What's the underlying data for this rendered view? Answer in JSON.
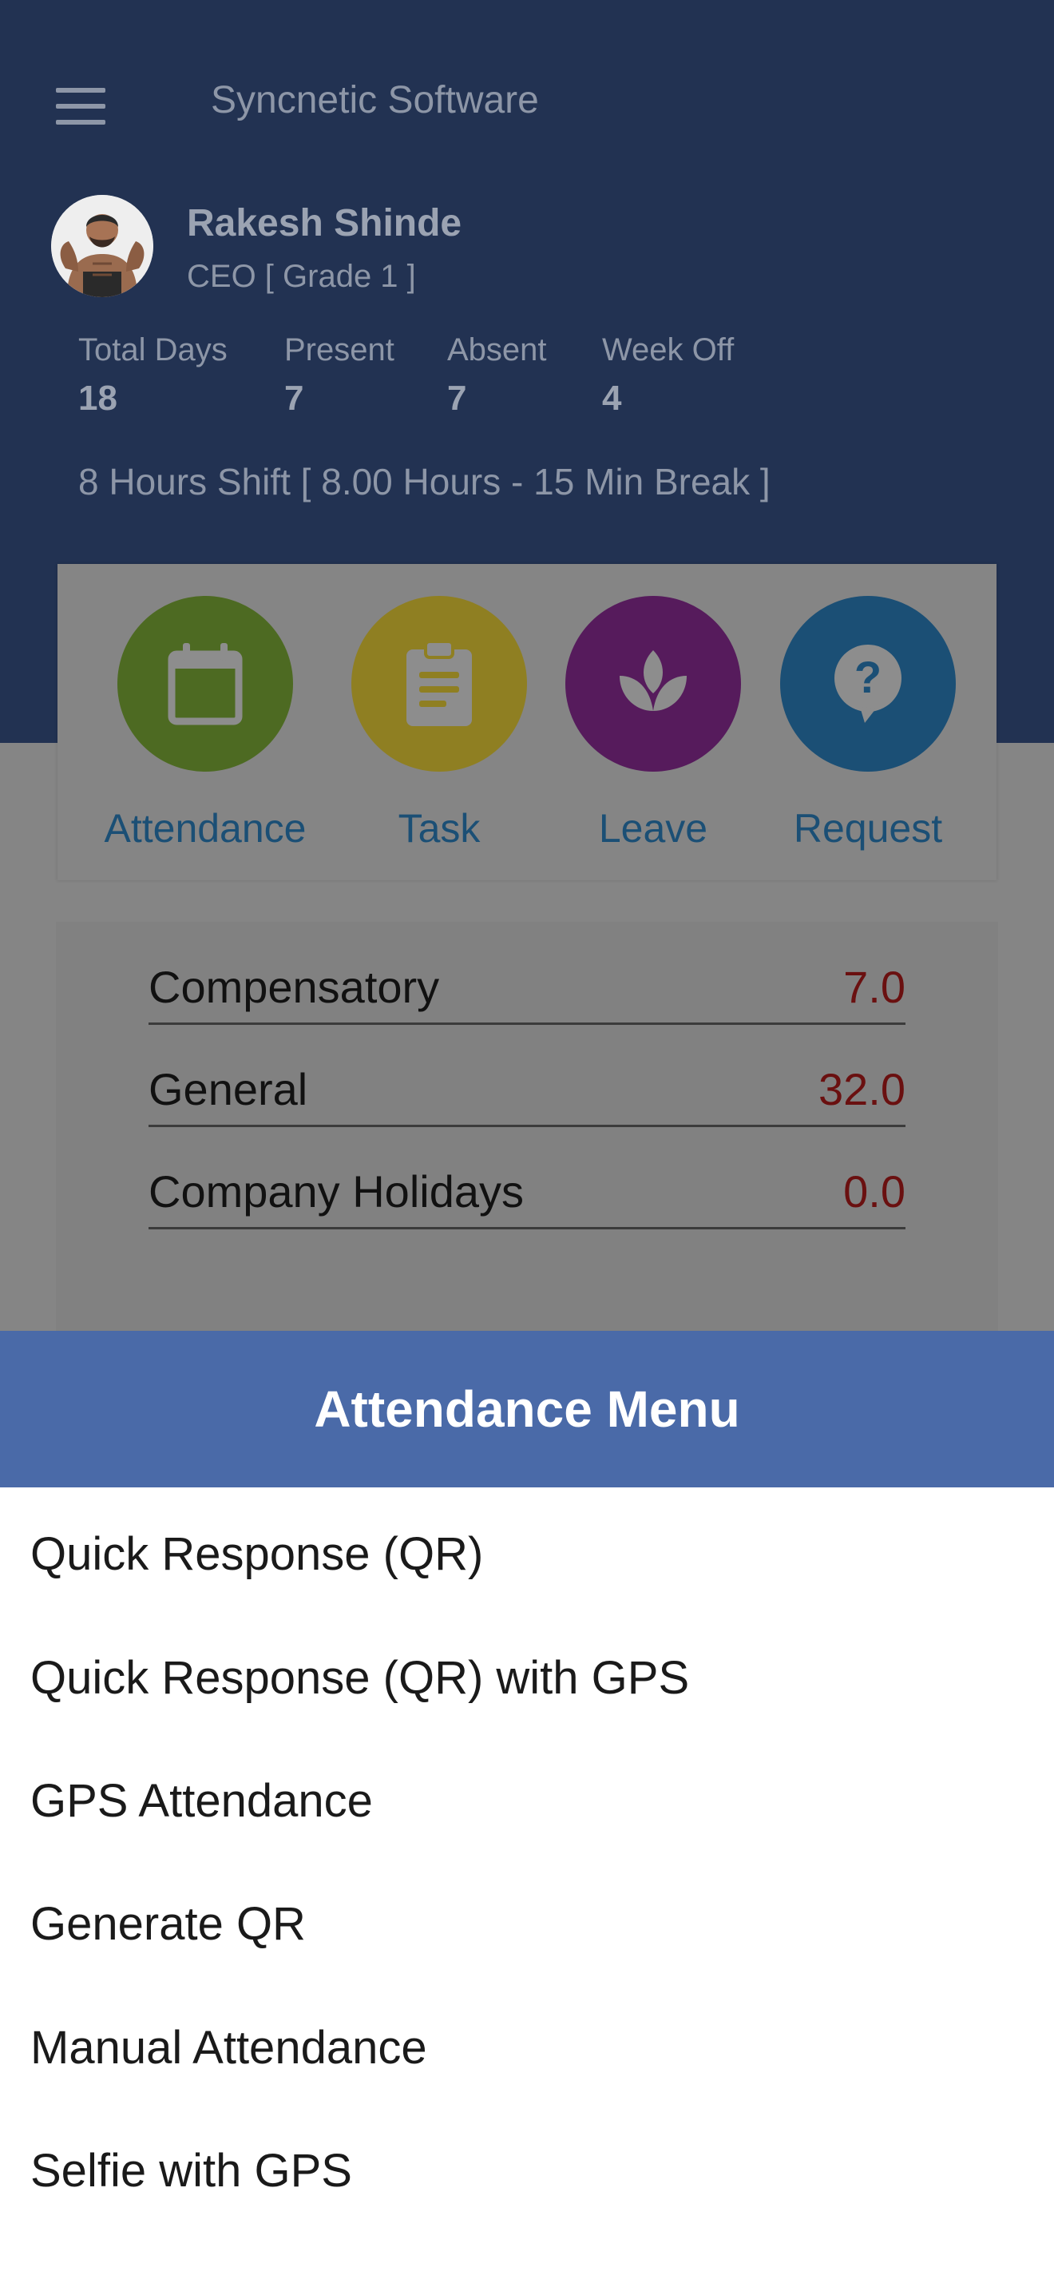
{
  "app": {
    "title": "Syncnetic Software"
  },
  "user": {
    "name": "Rakesh Shinde",
    "role": "CEO [ Grade 1 ]"
  },
  "stats": [
    {
      "label": "Total Days",
      "value": "18"
    },
    {
      "label": "Present",
      "value": "7"
    },
    {
      "label": "Absent",
      "value": "7"
    },
    {
      "label": "Week Off",
      "value": "4"
    }
  ],
  "shift": "8 Hours Shift [ 8.00 Hours - 15 Min Break ]",
  "quick_actions": [
    {
      "label": "Attendance",
      "icon": "calendar-icon",
      "color": "#4d6a22"
    },
    {
      "label": "Task",
      "icon": "clipboard-icon",
      "color": "#8f7f22"
    },
    {
      "label": "Leave",
      "icon": "lotus-icon",
      "color": "#561b5c"
    },
    {
      "label": "Request",
      "icon": "question-bubble-icon",
      "color": "#1b4f75"
    }
  ],
  "leave_balances": [
    {
      "name": "Compensatory",
      "value": "7.0"
    },
    {
      "name": "General",
      "value": "32.0"
    },
    {
      "name": "Company Holidays",
      "value": "0.0"
    }
  ],
  "attendance_menu": {
    "title": "Attendance Menu",
    "items": [
      "Quick Response (QR)",
      "Quick Response (QR) with GPS",
      "GPS Attendance",
      "Generate QR",
      "Manual Attendance",
      "Selfie with GPS"
    ]
  },
  "colors": {
    "header_bg": "#223252",
    "overlay_bg": "#858585",
    "sheet_header_bg": "#4a6aa8",
    "leave_value": "#6a1010",
    "quick_label": "#1b4f75"
  }
}
